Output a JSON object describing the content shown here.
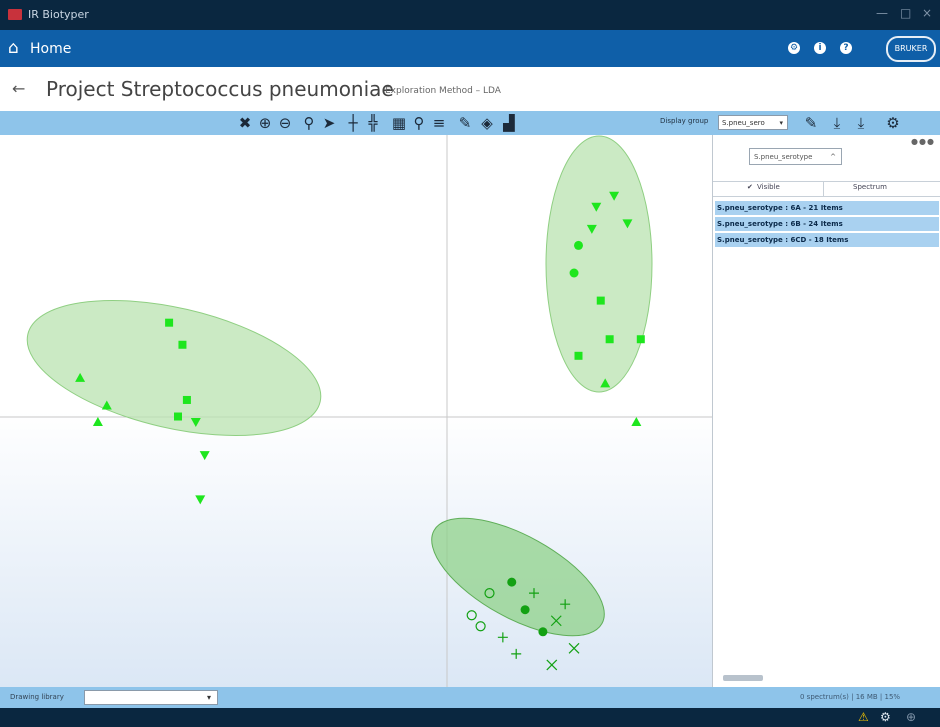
{
  "window": {
    "title": "IR Biotyper",
    "controls": [
      "—",
      "□",
      "×"
    ]
  },
  "nav": {
    "home_label": "Home",
    "logo": "BRUKER",
    "icons": [
      "settings-icon",
      "info-icon",
      "help-icon"
    ]
  },
  "project": {
    "title": "Project Streptococcus pneumoniae",
    "method": "Exploration Method – LDA"
  },
  "toolbar": {
    "display_group_label": "Display group",
    "display_group_value": "S.pneu_sero"
  },
  "panel": {
    "group_select": "S.pneu_serotype",
    "col_visible": "Visible",
    "col_spectrum": "Spectrum",
    "rows": [
      "S.pneu_serotype : 6A - 21 Items",
      "S.pneu_serotype : 6B - 24 Items",
      "S.pneu_serotype : 6CD - 18 Items"
    ]
  },
  "status": {
    "left_label": "Drawing library",
    "right_text": "0 spectrum(s) | 16 MB | 15%"
  },
  "colors": {
    "titlebar": "#0a2740",
    "navbar": "#0f5fa8",
    "toolbar": "#8ec4ea",
    "selected_row": "#a9d1f0",
    "cluster_fill": "#b9e3b0",
    "marker_bright": "#1ee61e",
    "marker_dark": "#13a113"
  },
  "chart_data": {
    "type": "scatter",
    "title": "",
    "xlabel": "",
    "ylabel": "",
    "xlim": [
      -10,
      6
    ],
    "ylim": [
      -5,
      5
    ],
    "series": [
      {
        "group": "6A",
        "color": "#1ee61e",
        "points": [
          [
            3.4,
            3.7,
            "tri-down"
          ],
          [
            3.8,
            3.9,
            "tri-down"
          ],
          [
            4.1,
            3.4,
            "tri-down"
          ],
          [
            3.0,
            3.0,
            "circle"
          ],
          [
            3.5,
            2.0,
            "square"
          ],
          [
            3.7,
            1.3,
            "square"
          ],
          [
            4.4,
            1.3,
            "square"
          ],
          [
            3.6,
            0.5,
            "triangle"
          ],
          [
            4.3,
            -0.2,
            "triangle"
          ],
          [
            3.0,
            1.0,
            "square"
          ],
          [
            3.3,
            3.3,
            "tri-down"
          ],
          [
            2.9,
            2.5,
            "circle"
          ]
        ]
      },
      {
        "group": "6B",
        "color": "#1ee61e",
        "points": [
          [
            -7.6,
            0.1,
            "triangle"
          ],
          [
            -8.2,
            0.6,
            "triangle"
          ],
          [
            -6.2,
            1.6,
            "square"
          ],
          [
            -5.8,
            0.2,
            "square"
          ],
          [
            -5.6,
            -0.2,
            "tri-down"
          ],
          [
            -5.5,
            -1.6,
            "tri-down"
          ],
          [
            -7.8,
            -0.2,
            "triangle"
          ],
          [
            -5.9,
            1.2,
            "square"
          ],
          [
            -5.4,
            -0.8,
            "tri-down"
          ],
          [
            -6.0,
            -0.1,
            "square"
          ]
        ]
      },
      {
        "group": "6CD",
        "color": "#13a113",
        "points": [
          [
            1.0,
            -3.3,
            "circle-open"
          ],
          [
            1.5,
            -3.1,
            "circle"
          ],
          [
            1.8,
            -3.6,
            "circle"
          ],
          [
            2.0,
            -3.3,
            "plus"
          ],
          [
            2.5,
            -3.8,
            "cross"
          ],
          [
            2.9,
            -4.3,
            "cross"
          ],
          [
            2.2,
            -4.0,
            "circle"
          ],
          [
            1.3,
            -4.1,
            "plus"
          ],
          [
            0.6,
            -3.7,
            "circle-open"
          ],
          [
            0.8,
            -3.9,
            "circle-open"
          ],
          [
            2.4,
            -4.6,
            "cross"
          ],
          [
            1.6,
            -4.4,
            "plus"
          ],
          [
            2.7,
            -3.5,
            "plus"
          ]
        ]
      }
    ]
  }
}
